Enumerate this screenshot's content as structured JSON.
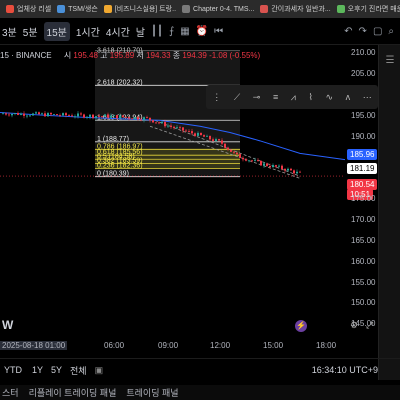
{
  "bookmarks": [
    {
      "label": "업체상 리셀",
      "color": "#e84d3d"
    },
    {
      "label": "TSM/생슨",
      "color": "#4a90d9"
    },
    {
      "label": "[비즈니스실용] 트랑..",
      "color": "#f0a830"
    },
    {
      "label": "Chapter 0-4. TMS...",
      "color": "#7a7a7a"
    },
    {
      "label": "간이과세자 일반과...",
      "color": "#d9534f"
    },
    {
      "label": "오후기 진라면 매운...",
      "color": "#5cb85c"
    },
    {
      "label": "레",
      "color": "#888888"
    }
  ],
  "toolbar": {
    "left_partial": "3분",
    "intervals": [
      "5분",
      "15분",
      "1시간",
      "4시간"
    ],
    "selected": "15분",
    "dropdown": "날"
  },
  "symbol": {
    "text": "15 · BINANCE",
    "o_label": "시",
    "o": "195.48",
    "h_label": "고",
    "h": "195.89",
    "l_label": "저",
    "l": "194.33",
    "c_label": "종",
    "c": "194.39",
    "change": "-1.08 (-0.55%)"
  },
  "fib": {
    "top_partial": "3.618 (210.70)",
    "levels": [
      {
        "label": "2.618 (202.32)",
        "price": 202.32,
        "color": "#e0e0e0"
      },
      {
        "label": "1.618 (193.94)",
        "price": 193.94,
        "color": "#e0e0e0"
      },
      {
        "label": "1 (188.77)",
        "price": 188.77,
        "color": "#e0e0e0"
      },
      {
        "label": "0.786 (186.97)",
        "price": 186.97,
        "color": "#e8d83a"
      },
      {
        "label": "0.618 (185.56)",
        "price": 185.56,
        "color": "#e8d83a"
      },
      {
        "label": "0.5 (184.58)",
        "price": 184.58,
        "color": "#e8d83a"
      },
      {
        "label": "0.382 (183.59)",
        "price": 183.59,
        "color": "#e8d83a"
      },
      {
        "label": "0.236 (182.36)",
        "price": 182.36,
        "color": "#e8d83a"
      },
      {
        "label": "0 (180.39)",
        "price": 180.39,
        "color": "#e0e0e0"
      }
    ]
  },
  "price_axis": {
    "ticks": [
      "210.00",
      "205.00",
      "200.00",
      "195.00",
      "190.00",
      "175.00",
      "170.00",
      "165.00",
      "160.00",
      "155.00",
      "150.00",
      "145.00"
    ],
    "labels": {
      "blue": "185.96",
      "white": "181.19",
      "red_price": "180.54",
      "red_timer": "10:51"
    }
  },
  "time_axis": {
    "current": "2025-08-18  01:00",
    "ticks": [
      "06:00",
      "09:00",
      "12:00",
      "15:00",
      "18:00"
    ]
  },
  "bottom_bar": {
    "items": [
      "YTD",
      "1Y",
      "5Y",
      "전체"
    ],
    "clock": "16:34:10 UTC+9"
  },
  "tabs": [
    "스터",
    "리플레이 트레이딩 패널",
    "트레이딩 패널"
  ],
  "watermark": "W",
  "chart_data": {
    "type": "candlestick",
    "ylim": [
      140,
      212
    ],
    "indicator": "moving average (blue)",
    "fib_retracement": true
  }
}
